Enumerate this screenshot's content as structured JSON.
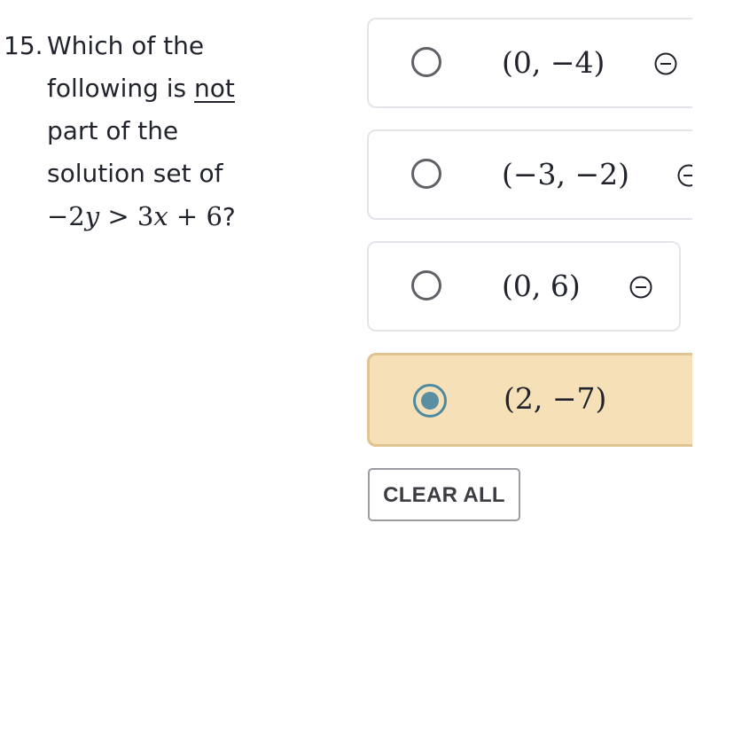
{
  "question": {
    "number": "15.",
    "line1": "Which of the",
    "line2_prefix": "following is ",
    "line2_emphasis": "not",
    "line3": "part of the",
    "line4": "solution set of",
    "inequality": {
      "left": "−2",
      "left_var": "y",
      "op": ">",
      "coef": "3",
      "var": "x",
      "plus": "+",
      "const": "6",
      "end": "?"
    }
  },
  "choices": [
    {
      "label": "(0, −4)",
      "selected": false,
      "icon": "cross-out-icon"
    },
    {
      "label": "(−3, −2)",
      "selected": false,
      "icon": "cross-out-icon"
    },
    {
      "label": "(0, 6)",
      "selected": false,
      "icon": "cross-out-icon"
    },
    {
      "label": "(2, −7)",
      "selected": true
    }
  ],
  "clear_all_label": "CLEAR ALL",
  "colors": {
    "selected_bg": "#f6e0b8",
    "selected_border": "#e0c491",
    "radio_selected": "#5a8fa3"
  }
}
